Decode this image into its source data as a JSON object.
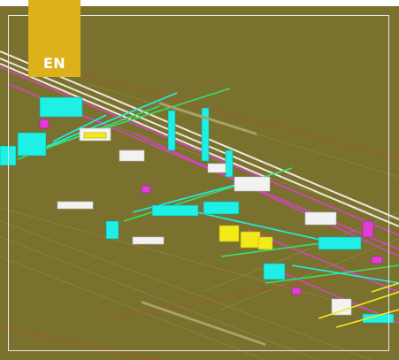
{
  "thumbnail": {
    "language_badge": "EN",
    "scene_icon": "cad-3d-plant-model-icon",
    "colors": {
      "background": "#7b712f",
      "page_edge": "#ffffff",
      "badge": "#ddb11a",
      "badge_text": "#ffffff",
      "frame": "#e9e9e9",
      "piping_cyan": "#1ef0e6",
      "piping_green": "#34e16a",
      "piping_magenta": "#e23cd6",
      "piping_yellow": "#f4ea1a",
      "equipment_white": "#f2f2f2",
      "red_cable": "#c8442a"
    }
  }
}
